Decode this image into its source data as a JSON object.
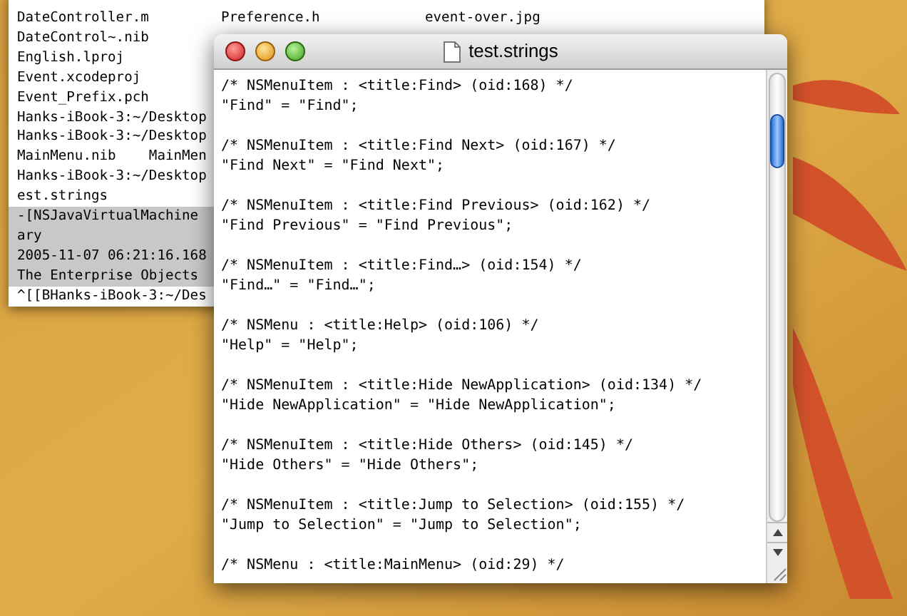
{
  "terminal": {
    "lines": [
      {
        "cells": [
          "DateController.m",
          "Preference.h",
          "event-over.jpg"
        ],
        "selected": false
      },
      {
        "cells": [
          "DateControl~.nib"
        ],
        "selected": false
      },
      {
        "cells": [
          "English.lproj"
        ],
        "selected": false
      },
      {
        "cells": [
          "Event.xcodeproj"
        ],
        "selected": false
      },
      {
        "cells": [
          "Event_Prefix.pch"
        ],
        "selected": false
      },
      {
        "cells": [
          "Hanks-iBook-3:~/Desktop"
        ],
        "selected": false
      },
      {
        "cells": [
          "Hanks-iBook-3:~/Desktop"
        ],
        "selected": false
      },
      {
        "cells": [
          "MainMenu.nib    MainMen"
        ],
        "selected": false
      },
      {
        "cells": [
          "Hanks-iBook-3:~/Desktop"
        ],
        "selected": false
      },
      {
        "cells": [
          "est.strings"
        ],
        "selected": false
      },
      {
        "cells": [
          "-[NSJavaVirtualMachine"
        ],
        "selected": true
      },
      {
        "cells": [
          "ary"
        ],
        "selected": true
      },
      {
        "cells": [
          "2005-11-07 06:21:16.168"
        ],
        "selected": true
      },
      {
        "cells": [
          "The Enterprise Objects"
        ],
        "selected": true
      },
      {
        "cells": [
          "^[[BHanks-iBook-3:~/Des"
        ],
        "selected": false
      }
    ]
  },
  "editor": {
    "title": "test.strings",
    "entries": [
      {
        "comment": "/* NSMenuItem : <title:Find> (oid:168) */",
        "line": "\"Find\" = \"Find\";"
      },
      {
        "comment": "/* NSMenuItem : <title:Find Next> (oid:167) */",
        "line": "\"Find Next\" = \"Find Next\";"
      },
      {
        "comment": "/* NSMenuItem : <title:Find Previous> (oid:162) */",
        "line": "\"Find Previous\" = \"Find Previous\";"
      },
      {
        "comment": "/* NSMenuItem : <title:Find…> (oid:154) */",
        "line": "\"Find…\" = \"Find…\";"
      },
      {
        "comment": "/* NSMenu : <title:Help> (oid:106) */",
        "line": "\"Help\" = \"Help\";"
      },
      {
        "comment": "/* NSMenuItem : <title:Hide NewApplication> (oid:134) */",
        "line": "\"Hide NewApplication\" = \"Hide NewApplication\";"
      },
      {
        "comment": "/* NSMenuItem : <title:Hide Others> (oid:145) */",
        "line": "\"Hide Others\" = \"Hide Others\";"
      },
      {
        "comment": "/* NSMenuItem : <title:Jump to Selection> (oid:155) */",
        "line": "\"Jump to Selection\" = \"Jump to Selection\";"
      },
      {
        "comment": "/* NSMenu : <title:MainMenu> (oid:29) */"
      }
    ]
  }
}
